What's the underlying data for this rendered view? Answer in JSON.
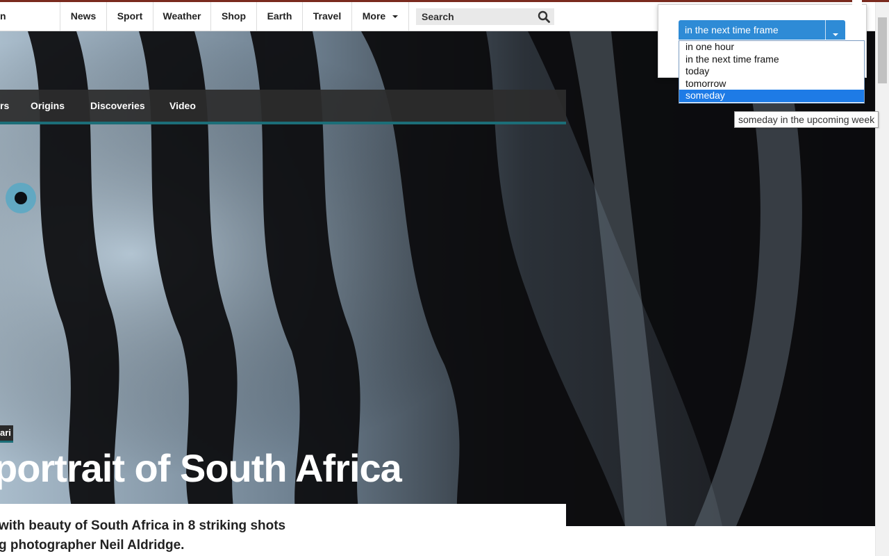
{
  "nav": {
    "fragment": "n",
    "items": [
      "News",
      "Sport",
      "Weather",
      "Shop",
      "Earth",
      "Travel",
      "More"
    ],
    "search_label": "Search"
  },
  "subnav": {
    "items": [
      "rs",
      "Origins",
      "Discoveries",
      "Video"
    ]
  },
  "article": {
    "tag": "ari",
    "headline": "portrait of South Africa",
    "standfirst_line1": "with beauty of South Africa in 8 striking shots",
    "standfirst_line2": "g photographer Neil Aldridge."
  },
  "dropdown": {
    "selected": "in the next time frame",
    "options": [
      "in one hour",
      "in the next time frame",
      "today",
      "tomorrow",
      "someday"
    ],
    "highlighted_index": 4,
    "tooltip": "someday in the upcoming week"
  },
  "colors": {
    "accent": "#2e8bd6",
    "highlight": "#1e7be6",
    "teal_rule": "#1c6e78"
  }
}
